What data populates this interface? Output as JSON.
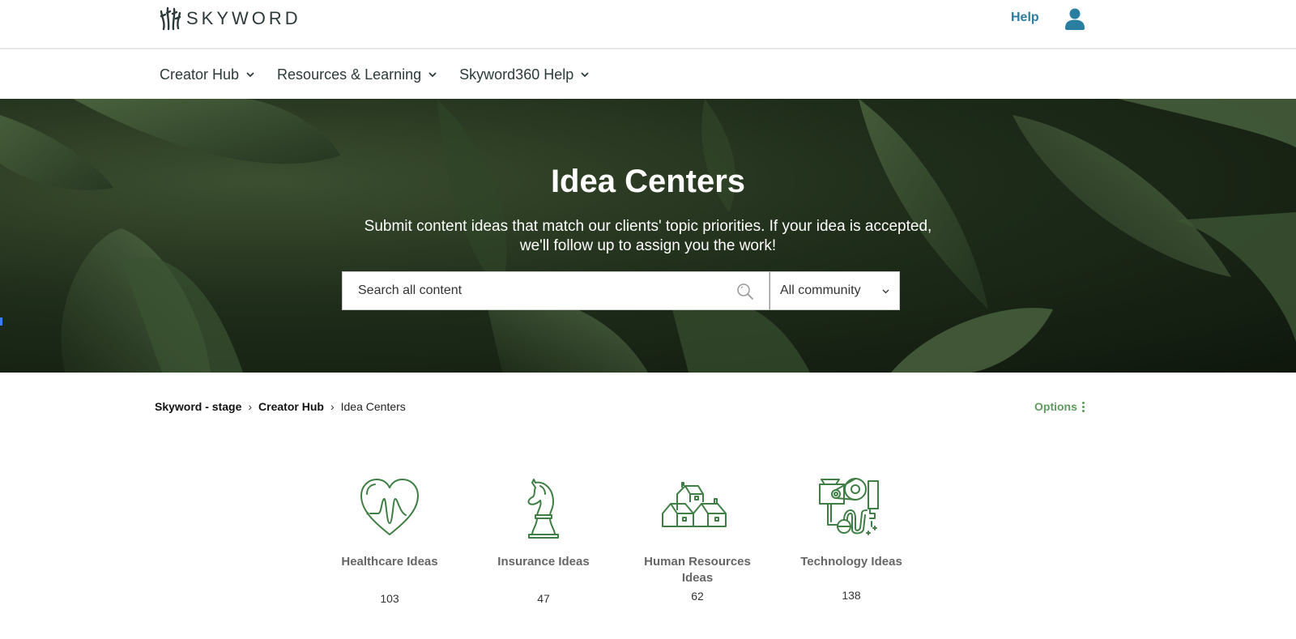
{
  "header": {
    "logo_text": "SKYWORD",
    "help_label": "Help"
  },
  "nav": {
    "items": [
      {
        "label": "Creator Hub"
      },
      {
        "label": "Resources & Learning"
      },
      {
        "label": "Skyword360 Help"
      }
    ]
  },
  "hero": {
    "title": "Idea Centers",
    "subtitle": "Submit content ideas that match our clients' topic priorities. If your idea is accepted, we'll follow up to assign you the work!",
    "search_placeholder": "Search all content",
    "search_value": "",
    "scope_selected": "All community"
  },
  "breadcrumb": {
    "items": [
      "Skyword - stage",
      "Creator Hub"
    ],
    "current": "Idea Centers",
    "separator": "›"
  },
  "options_label": "Options",
  "cards": [
    {
      "title": "Healthcare Ideas",
      "count": "103",
      "icon": "heart-pulse-icon"
    },
    {
      "title": "Insurance Ideas",
      "count": "47",
      "icon": "chess-knight-icon"
    },
    {
      "title": "Human Resources Ideas",
      "count": "62",
      "icon": "houses-icon"
    },
    {
      "title": "Technology Ideas",
      "count": "138",
      "icon": "machine-icon"
    }
  ],
  "colors": {
    "brand_text": "#2d3a3a",
    "help_blue": "#2a7fa0",
    "accent_green": "#3f7f45",
    "options_green": "#5e9b5e"
  }
}
